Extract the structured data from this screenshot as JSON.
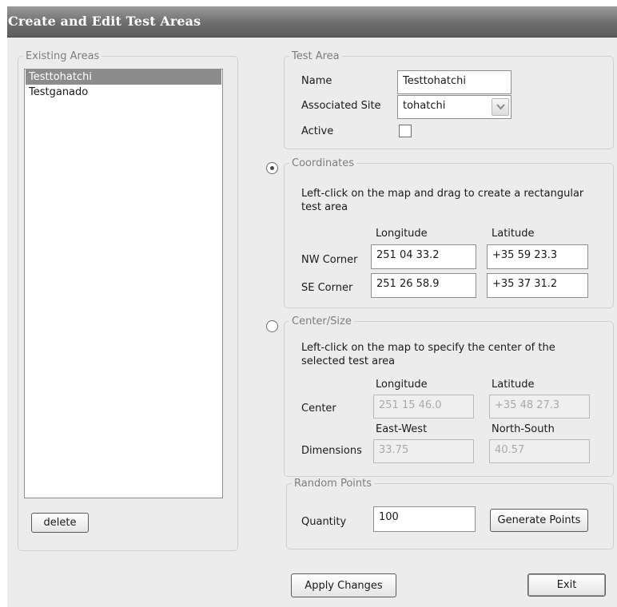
{
  "window": {
    "title": "Create and Edit Test Areas"
  },
  "existing_areas": {
    "legend": "Existing Areas",
    "items": [
      {
        "label": "Testtohatchi",
        "selected": true
      },
      {
        "label": "Testganado",
        "selected": false
      }
    ],
    "delete_label": "delete"
  },
  "test_area": {
    "legend": "Test Area",
    "name_label": "Name",
    "name_value": "Testtohatchi",
    "site_label": "Associated Site",
    "site_value": "tohatchi",
    "active_label": "Active",
    "active_checked": false
  },
  "coordinates": {
    "legend": "Coordinates",
    "selected": true,
    "instruction": "Left-click on the map and drag to create a rectangular test area",
    "longitude_header": "Longitude",
    "latitude_header": "Latitude",
    "nw_label": "NW Corner",
    "nw_longitude": "251 04 33.2",
    "nw_latitude": "+35 59 23.3",
    "se_label": "SE Corner",
    "se_longitude": "251 26 58.9",
    "se_latitude": "+35 37 31.2"
  },
  "center_size": {
    "legend": "Center/Size",
    "selected": false,
    "instruction": "Left-click on the map to specify the center of the selected test area",
    "longitude_header": "Longitude",
    "latitude_header": "Latitude",
    "center_label": "Center",
    "center_longitude": "251 15 46.0",
    "center_latitude": "+35 48 27.3",
    "ew_header": "East-West",
    "ns_header": "North-South",
    "dimensions_label": "Dimensions",
    "dim_ew": "33.75",
    "dim_ns": "40.57"
  },
  "random_points": {
    "legend": "Random Points",
    "quantity_label": "Quantity",
    "quantity_value": "100",
    "generate_label": "Generate Points"
  },
  "footer": {
    "apply_label": "Apply Changes",
    "exit_label": "Exit"
  }
}
